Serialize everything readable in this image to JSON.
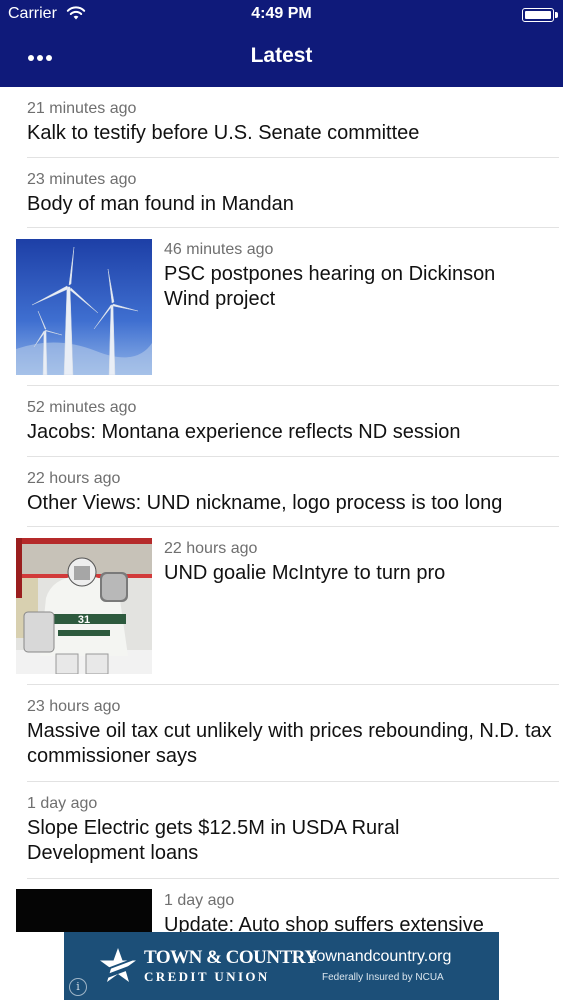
{
  "status_bar": {
    "carrier": "Carrier",
    "time": "4:49 PM"
  },
  "nav": {
    "title": "Latest",
    "menu_icon": "more-dots-icon"
  },
  "feed": [
    {
      "time": "21 minutes ago",
      "headline": "Kalk to testify before U.S. Senate committee"
    },
    {
      "time": "23 minutes ago",
      "headline": "Body of man found in Mandan"
    },
    {
      "time": "46 minutes ago",
      "headline": "PSC postpones hearing on Dickinson Wind project",
      "thumbnail": "wind-turbines-photo"
    },
    {
      "time": "52 minutes ago",
      "headline": "Jacobs: Montana experience reflects ND session"
    },
    {
      "time": "22 hours ago",
      "headline": "Other Views: UND nickname, logo process is too long"
    },
    {
      "time": "22 hours ago",
      "headline": "UND goalie McIntyre to turn pro",
      "thumbnail": "hockey-goalie-photo",
      "jersey_number": "31"
    },
    {
      "time": "23 hours ago",
      "headline": "Massive oil tax cut unlikely with prices rebounding, N.D. tax commissioner says"
    },
    {
      "time": "1 day ago",
      "headline": "Slope Electric gets $12.5M in USDA Rural Development loans"
    },
    {
      "time": "1 day ago",
      "headline": "Update: Auto shop suffers extensive",
      "thumbnail": "dark-photo"
    }
  ],
  "ad": {
    "brand_line1": "TOWN & COUNTRY",
    "brand_line2": "CREDIT UNION",
    "url": "townandcountry.org",
    "fine_print": "Federally Insured by NCUA",
    "info_label": "i",
    "background_color": "#1c4f78"
  },
  "colors": {
    "nav_bar": "#0f1a7a",
    "timestamp": "#6f6f6f",
    "headline": "#111111"
  }
}
